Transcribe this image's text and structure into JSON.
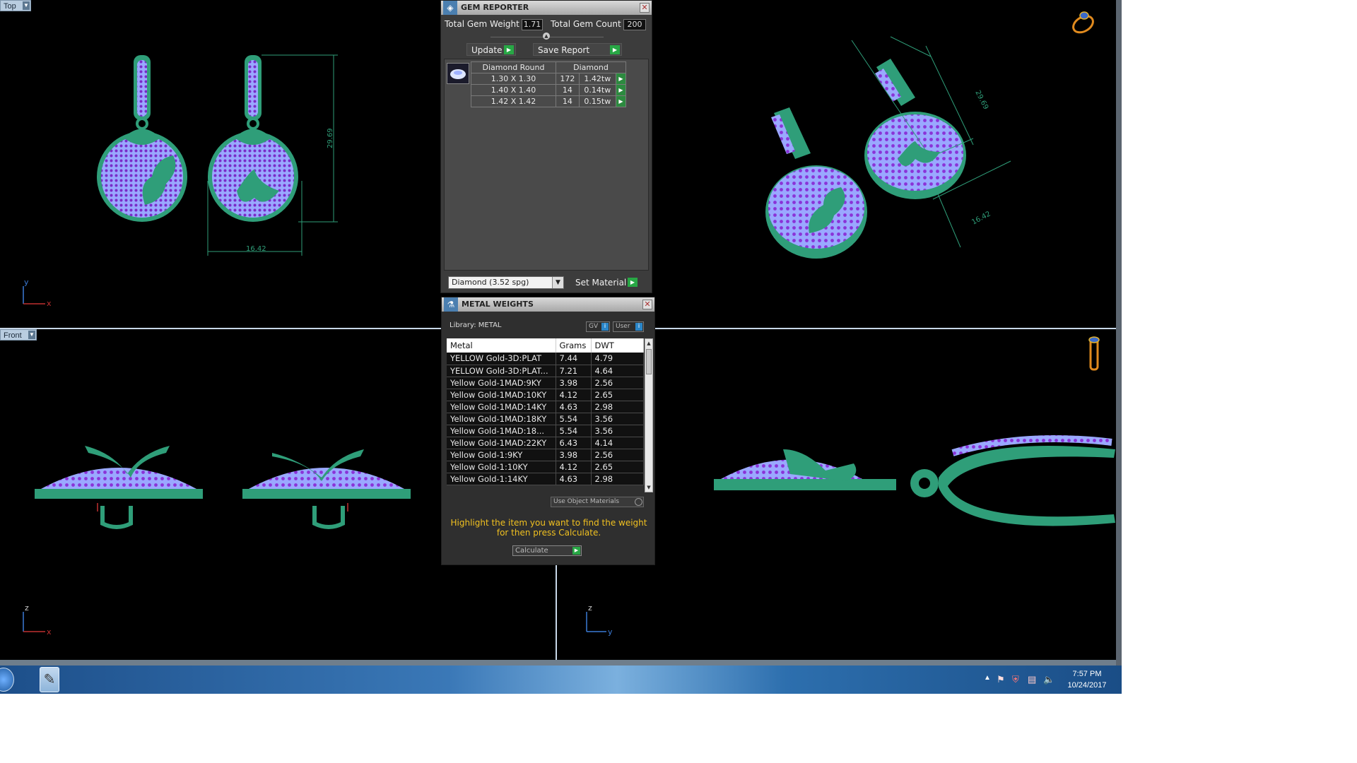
{
  "viewports": {
    "top_label": "Top",
    "front_label": "Front",
    "top_dim_height": "29.69",
    "top_dim_width": "16.42",
    "persp_dim_height": "29.69",
    "persp_dim_width": "16.42",
    "axis_x": "x",
    "axis_y": "y",
    "axis_z": "z"
  },
  "gem_reporter": {
    "title": "GEM REPORTER",
    "total_weight_label": "Total Gem Weight",
    "total_weight_value": "1.71",
    "total_count_label": "Total Gem Count",
    "total_count_value": "200",
    "update_label": "Update",
    "save_report_label": "Save Report",
    "table_header_shape": "Diamond Round",
    "table_header_material": "Diamond",
    "rows": [
      {
        "size": "1.30 X 1.30",
        "count": "172",
        "weight": "1.42tw"
      },
      {
        "size": "1.40 X 1.40",
        "count": "14",
        "weight": "0.14tw"
      },
      {
        "size": "1.42 X 1.42",
        "count": "14",
        "weight": "0.15tw"
      }
    ],
    "material_select": "Diamond     (3.52 spg)",
    "set_material_label": "Set Material"
  },
  "metal_weights": {
    "title": "METAL WEIGHTS",
    "library_label": "Library: METAL",
    "gv_label": "GV",
    "user_label": "User",
    "columns": [
      "Metal",
      "Grams",
      "DWT"
    ],
    "rows": [
      {
        "metal": "YELLOW Gold-3D:PLAT",
        "grams": "7.44",
        "dwt": "4.79"
      },
      {
        "metal": "YELLOW Gold-3D:PLAT...",
        "grams": "7.21",
        "dwt": "4.64"
      },
      {
        "metal": "Yellow Gold-1MAD:9KY",
        "grams": "3.98",
        "dwt": "2.56"
      },
      {
        "metal": "Yellow Gold-1MAD:10KY",
        "grams": "4.12",
        "dwt": "2.65"
      },
      {
        "metal": "Yellow Gold-1MAD:14KY",
        "grams": "4.63",
        "dwt": "2.98"
      },
      {
        "metal": "Yellow Gold-1MAD:18KY",
        "grams": "5.54",
        "dwt": "3.56"
      },
      {
        "metal": "Yellow Gold-1MAD:18...",
        "grams": "5.54",
        "dwt": "3.56"
      },
      {
        "metal": "Yellow Gold-1MAD:22KY",
        "grams": "6.43",
        "dwt": "4.14"
      },
      {
        "metal": "Yellow Gold-1:9KY",
        "grams": "3.98",
        "dwt": "2.56"
      },
      {
        "metal": "Yellow Gold-1:10KY",
        "grams": "4.12",
        "dwt": "2.65"
      },
      {
        "metal": "Yellow Gold-1:14KY",
        "grams": "4.63",
        "dwt": "2.98"
      }
    ],
    "use_object_materials_label": "Use Object Materials",
    "hint": "Highlight the item you want to find the weight for then press Calculate.",
    "calculate_label": "Calculate"
  },
  "taskbar": {
    "time": "7:57 PM",
    "date": "10/24/2017"
  }
}
